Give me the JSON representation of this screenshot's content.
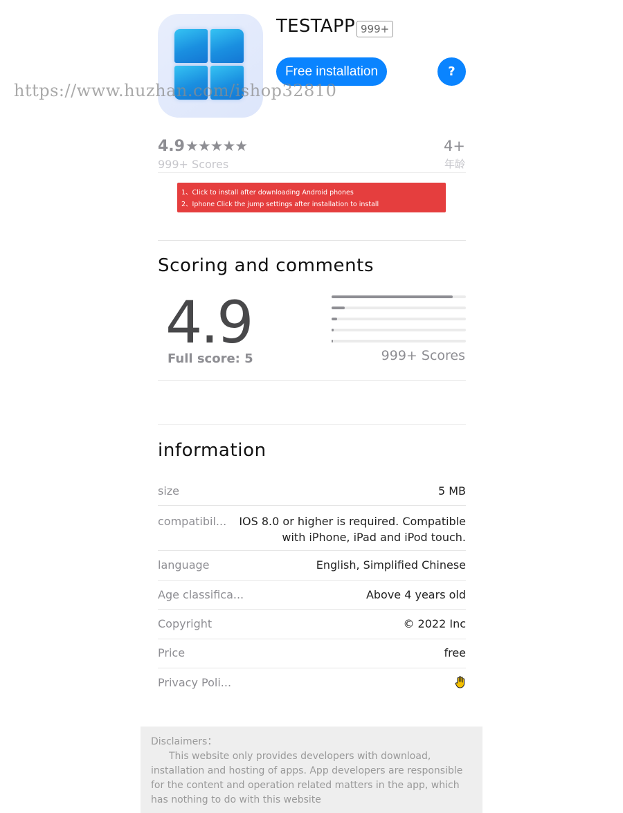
{
  "app": {
    "title": "TESTAPP",
    "count_badge": "999+",
    "install_label": "Free installation",
    "help_label": "?",
    "icon": "windows-logo-icon"
  },
  "watermark": "https://www.huzhan.com/ishop32810",
  "rating_summary": {
    "score": "4.9",
    "stars": "★★★★★",
    "scores_text": "999+ Scores",
    "age": "4+",
    "age_label": "年龄"
  },
  "notice": {
    "line1": "1、Click to install after downloading Android phones",
    "line2": "2、Iphone Click the jump settings after installation to install",
    "color": "#e53e3e"
  },
  "scoring": {
    "title": "Scoring and comments",
    "big_score": "4.9",
    "full_score": "Full score: 5",
    "distribution": [
      0.9,
      0.1,
      0.04,
      0.015,
      0.01
    ],
    "scores_text": "999+ Scores"
  },
  "information": {
    "title": "information",
    "rows": [
      {
        "label": "size",
        "value": "5 MB"
      },
      {
        "label": "compatibil...",
        "value": "IOS 8.0 or higher is required. Compatible with iPhone, iPad and iPod touch."
      },
      {
        "label": "language",
        "value": "English, Simplified Chinese"
      },
      {
        "label": "Age classifica...",
        "value": "Above 4 years old"
      },
      {
        "label": "Copyright",
        "value": "© 2022 Inc"
      },
      {
        "label": "Price",
        "value": "free"
      },
      {
        "label": "Privacy Poli...",
        "value": "",
        "icon": "raised-hand-icon"
      }
    ]
  },
  "disclaimer": {
    "title": "Disclaimers：",
    "body": "This website only provides developers with download, installation and hosting of apps. App developers are responsible for the content and operation related matters in the app, which has nothing to do with this website"
  },
  "colors": {
    "accent": "#0a84ff",
    "notice_red": "#e53e3e",
    "muted": "#8e8e93"
  }
}
